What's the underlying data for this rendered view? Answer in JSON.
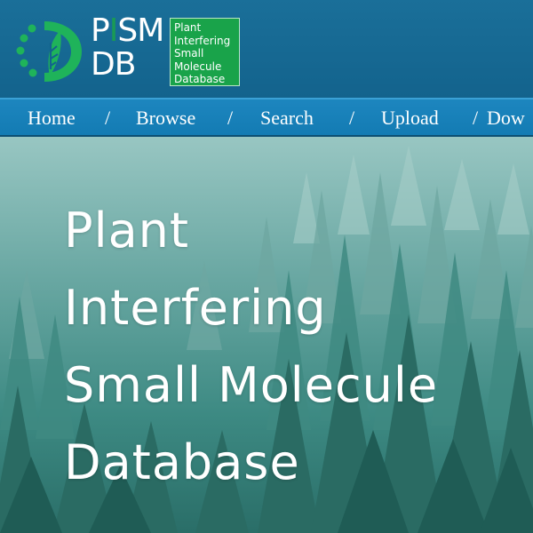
{
  "header": {
    "logo_line1": {
      "p": "P",
      "i": "I",
      "sm": "SM"
    },
    "logo_line2": "DB",
    "badge_lines": [
      "Plant",
      "Interfering",
      "Small",
      "Molecule",
      "Database"
    ]
  },
  "nav": {
    "items": [
      "Home",
      "Browse",
      "Search",
      "Upload",
      "Dow"
    ],
    "separator": "/"
  },
  "hero": {
    "title_lines": [
      "Plant",
      "Interfering",
      "Small Molecule",
      "Database"
    ]
  },
  "colors": {
    "header_bg": "#13638d",
    "nav_bg": "#1a7fb8",
    "badge_green": "#19a34a",
    "logo_green": "#1a9a55",
    "forest_dark": "#2a6e68"
  },
  "icons": {
    "logo": "plant-leaf-circle-logo-icon"
  }
}
